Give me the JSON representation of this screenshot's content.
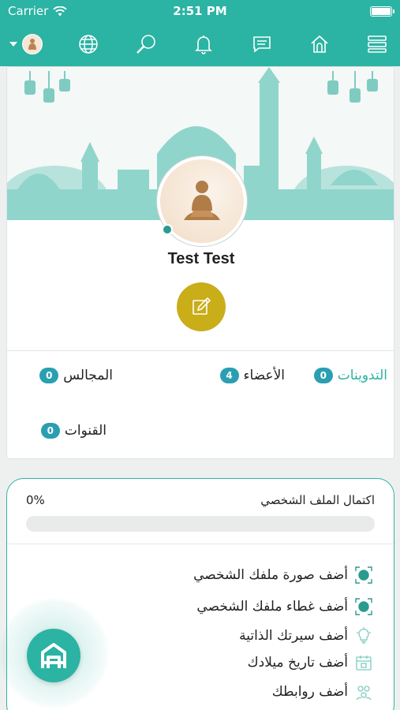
{
  "status_bar": {
    "carrier": "Carrier",
    "time": "2:51 PM"
  },
  "nav": {
    "icons": [
      "menu-icon",
      "home-icon",
      "messages-icon",
      "bell-icon",
      "search-icon",
      "globe-icon",
      "avatar",
      "dropdown-arrow-icon"
    ]
  },
  "profile": {
    "name": "Test Test",
    "stats": [
      {
        "label": "التدوينات",
        "count": "0"
      },
      {
        "label": "الأعضاء",
        "count": "4"
      },
      {
        "label": "المجالس",
        "count": "0"
      },
      {
        "label": "القنوات",
        "count": "0"
      }
    ]
  },
  "completion": {
    "title": "اكتمال الملف الشخصي",
    "percent_label": "0%",
    "percent": 0,
    "tasks": [
      {
        "label": "أضف صورة ملفك الشخصي",
        "icon": "profile-photo-icon"
      },
      {
        "label": "أضف غطاء ملفك الشخصي",
        "icon": "cover-photo-icon"
      },
      {
        "label": "أضف سيرتك الذاتية",
        "icon": "lightbulb-icon"
      },
      {
        "label": "أضف تاريخ ميلادك",
        "icon": "calendar-icon"
      },
      {
        "label": "أضف روابطك",
        "icon": "links-icon"
      }
    ]
  },
  "colors": {
    "primary": "#2bb3a3",
    "badge": "#2a9fb2",
    "edit": "#c9ad19"
  }
}
